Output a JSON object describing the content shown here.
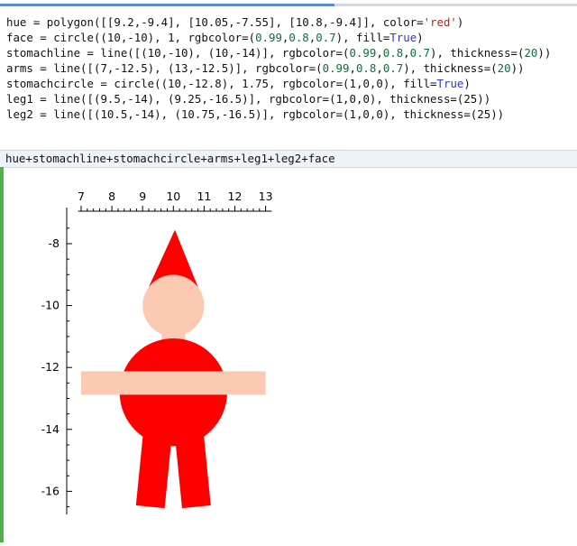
{
  "code_lines": [
    [
      {
        "t": "hue = polygon([[",
        "c": ""
      },
      {
        "t": "9.2",
        "c": ""
      },
      {
        "t": ",-",
        "c": ""
      },
      {
        "t": "9.4",
        "c": ""
      },
      {
        "t": "], [",
        "c": ""
      },
      {
        "t": "10.05",
        "c": ""
      },
      {
        "t": ",-",
        "c": ""
      },
      {
        "t": "7.55",
        "c": ""
      },
      {
        "t": "], [",
        "c": ""
      },
      {
        "t": "10.8",
        "c": ""
      },
      {
        "t": ",-",
        "c": ""
      },
      {
        "t": "9.4",
        "c": ""
      },
      {
        "t": "]], color=",
        "c": ""
      },
      {
        "t": "'red'",
        "c": "str"
      },
      {
        "t": ")",
        "c": ""
      }
    ],
    [
      {
        "t": "face = circle((",
        "c": ""
      },
      {
        "t": "10",
        "c": ""
      },
      {
        "t": ",-",
        "c": ""
      },
      {
        "t": "10",
        "c": ""
      },
      {
        "t": "), ",
        "c": ""
      },
      {
        "t": "1",
        "c": ""
      },
      {
        "t": ", rgbcolor=(",
        "c": ""
      },
      {
        "t": "0.99",
        "c": "num"
      },
      {
        "t": ",",
        "c": ""
      },
      {
        "t": "0.8",
        "c": "num"
      },
      {
        "t": ",",
        "c": ""
      },
      {
        "t": "0.7",
        "c": "num"
      },
      {
        "t": "), fill=",
        "c": ""
      },
      {
        "t": "True",
        "c": "kw"
      },
      {
        "t": ")",
        "c": ""
      }
    ],
    [
      {
        "t": "stomachline = line([(",
        "c": ""
      },
      {
        "t": "10",
        "c": ""
      },
      {
        "t": ",-",
        "c": ""
      },
      {
        "t": "10",
        "c": ""
      },
      {
        "t": "), (",
        "c": ""
      },
      {
        "t": "10",
        "c": ""
      },
      {
        "t": ",-",
        "c": ""
      },
      {
        "t": "14",
        "c": ""
      },
      {
        "t": ")], rgbcolor=(",
        "c": ""
      },
      {
        "t": "0.99",
        "c": "num"
      },
      {
        "t": ",",
        "c": ""
      },
      {
        "t": "0.8",
        "c": "num"
      },
      {
        "t": ",",
        "c": ""
      },
      {
        "t": "0.7",
        "c": "num"
      },
      {
        "t": "), thickness=(",
        "c": ""
      },
      {
        "t": "20",
        "c": "num"
      },
      {
        "t": "))",
        "c": ""
      }
    ],
    [
      {
        "t": "arms = line([(",
        "c": ""
      },
      {
        "t": "7",
        "c": ""
      },
      {
        "t": ",-",
        "c": ""
      },
      {
        "t": "12.5",
        "c": ""
      },
      {
        "t": "), (",
        "c": ""
      },
      {
        "t": "13",
        "c": ""
      },
      {
        "t": ",-",
        "c": ""
      },
      {
        "t": "12.5",
        "c": ""
      },
      {
        "t": ")], rgbcolor=(",
        "c": ""
      },
      {
        "t": "0.99",
        "c": "num"
      },
      {
        "t": ",",
        "c": ""
      },
      {
        "t": "0.8",
        "c": "num"
      },
      {
        "t": ",",
        "c": ""
      },
      {
        "t": "0.7",
        "c": "num"
      },
      {
        "t": "), thickness=(",
        "c": ""
      },
      {
        "t": "20",
        "c": "num"
      },
      {
        "t": "))",
        "c": ""
      }
    ],
    [
      {
        "t": "stomachcircle = circle((",
        "c": ""
      },
      {
        "t": "10",
        "c": ""
      },
      {
        "t": ",-",
        "c": ""
      },
      {
        "t": "12.8",
        "c": ""
      },
      {
        "t": "), ",
        "c": ""
      },
      {
        "t": "1.75",
        "c": ""
      },
      {
        "t": ", rgbcolor=(",
        "c": ""
      },
      {
        "t": "1",
        "c": ""
      },
      {
        "t": ",",
        "c": ""
      },
      {
        "t": "0",
        "c": ""
      },
      {
        "t": ",",
        "c": ""
      },
      {
        "t": "0",
        "c": ""
      },
      {
        "t": "), fill=",
        "c": ""
      },
      {
        "t": "True",
        "c": "kw"
      },
      {
        "t": ")",
        "c": ""
      }
    ],
    [
      {
        "t": "leg1 = line([(",
        "c": ""
      },
      {
        "t": "9.5",
        "c": ""
      },
      {
        "t": ",-",
        "c": ""
      },
      {
        "t": "14",
        "c": ""
      },
      {
        "t": "), (",
        "c": ""
      },
      {
        "t": "9.25",
        "c": ""
      },
      {
        "t": ",-",
        "c": ""
      },
      {
        "t": "16.5",
        "c": ""
      },
      {
        "t": ")], rgbcolor=(",
        "c": ""
      },
      {
        "t": "1",
        "c": ""
      },
      {
        "t": ",",
        "c": ""
      },
      {
        "t": "0",
        "c": ""
      },
      {
        "t": ",",
        "c": ""
      },
      {
        "t": "0",
        "c": ""
      },
      {
        "t": "), thickness=(",
        "c": ""
      },
      {
        "t": "25",
        "c": ""
      },
      {
        "t": "))",
        "c": ""
      }
    ],
    [
      {
        "t": "leg2 = line([(",
        "c": ""
      },
      {
        "t": "10.5",
        "c": ""
      },
      {
        "t": ",-",
        "c": ""
      },
      {
        "t": "14",
        "c": ""
      },
      {
        "t": "), (",
        "c": ""
      },
      {
        "t": "10.75",
        "c": ""
      },
      {
        "t": ",-",
        "c": ""
      },
      {
        "t": "16.5",
        "c": ""
      },
      {
        "t": ")], rgbcolor=(",
        "c": ""
      },
      {
        "t": "1",
        "c": ""
      },
      {
        "t": ",",
        "c": ""
      },
      {
        "t": "0",
        "c": ""
      },
      {
        "t": ",",
        "c": ""
      },
      {
        "t": "0",
        "c": ""
      },
      {
        "t": "), thickness=(",
        "c": ""
      },
      {
        "t": "25",
        "c": ""
      },
      {
        "t": "))",
        "c": ""
      }
    ]
  ],
  "input_text": "hue+stomachline+stomachcircle+arms+leg1+leg2+face",
  "progress": 0.58,
  "colors": {
    "red": "#ff0000",
    "skin": "#fccab3",
    "accent": "#5b8ec9",
    "output_marker": "#53b14a"
  },
  "plot": {
    "x_ticks": [
      "7",
      "8",
      "9",
      "10",
      "11",
      "12",
      "13"
    ],
    "y_ticks": [
      "-8",
      "-10",
      "-12",
      "-14",
      "-16"
    ],
    "x_tick_values": [
      7,
      8,
      9,
      10,
      11,
      12,
      13
    ],
    "y_tick_values": [
      -8,
      -10,
      -12,
      -14,
      -16
    ]
  }
}
